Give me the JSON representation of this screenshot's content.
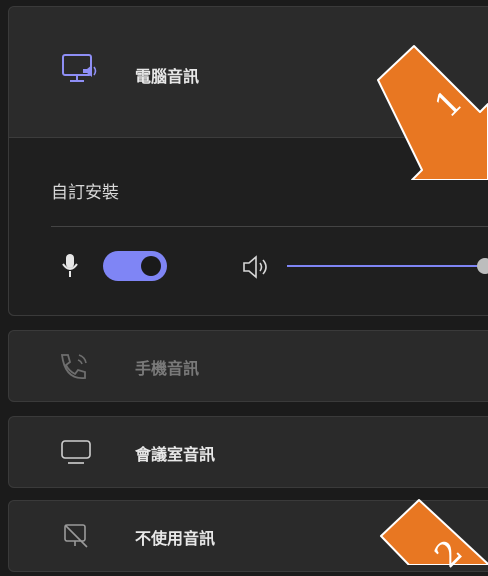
{
  "options": {
    "computer_audio": {
      "label": "電腦音訊",
      "custom_setup_label": "自訂安裝",
      "mic_enabled": true,
      "speaker_volume": 1.0
    },
    "phone_audio": {
      "label": "手機音訊"
    },
    "room_audio": {
      "label": "會議室音訊"
    },
    "no_audio": {
      "label": "不使用音訊"
    }
  },
  "annotations": {
    "step1": "1",
    "step2": "2"
  },
  "colors": {
    "accent": "#7f85f5",
    "annotation": "#e87722"
  }
}
